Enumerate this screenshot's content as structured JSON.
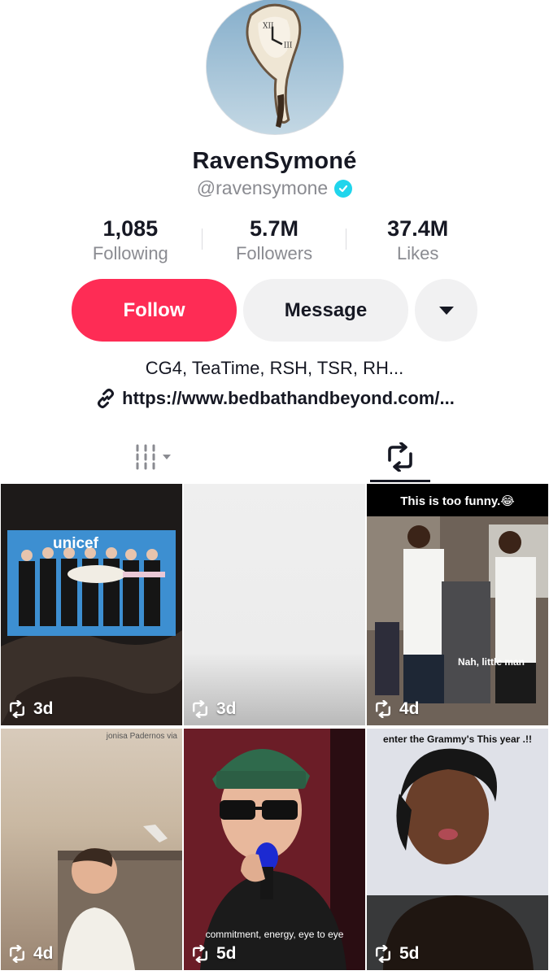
{
  "profile": {
    "display_name": "RavenSymoné",
    "handle": "@ravensymone",
    "verified": true,
    "bio": "CG4, TeaTime, RSH, TSR, RH...",
    "link": "https://www.bedbathandbeyond.com/..."
  },
  "stats": [
    {
      "value": "1,085",
      "label": "Following"
    },
    {
      "value": "5.7M",
      "label": "Followers"
    },
    {
      "value": "37.4M",
      "label": "Likes"
    }
  ],
  "actions": {
    "follow": "Follow",
    "message": "Message"
  },
  "colors": {
    "follow_bg": "#fe2c55",
    "verified": "#20d5ec",
    "secondary_button_bg": "#f1f1f2"
  },
  "tabs": {
    "active": "reposts",
    "items": [
      {
        "id": "videos",
        "icon": "grid-bars-icon"
      },
      {
        "id": "reposts",
        "icon": "repost-icon"
      }
    ]
  },
  "videos": [
    {
      "age": "3d",
      "overlay": ""
    },
    {
      "age": "3d",
      "overlay": ""
    },
    {
      "age": "4d",
      "overlay": "This is too funny.😂",
      "overlay2": "Nah, little man"
    },
    {
      "age": "4d",
      "overlay": "jonisa Padernos via"
    },
    {
      "age": "5d",
      "overlay": "commitment, energy, eye to eye"
    },
    {
      "age": "5d",
      "overlay": "enter the Grammy's This year .!!"
    }
  ],
  "thumb1": {
    "unicef": "unicef"
  }
}
